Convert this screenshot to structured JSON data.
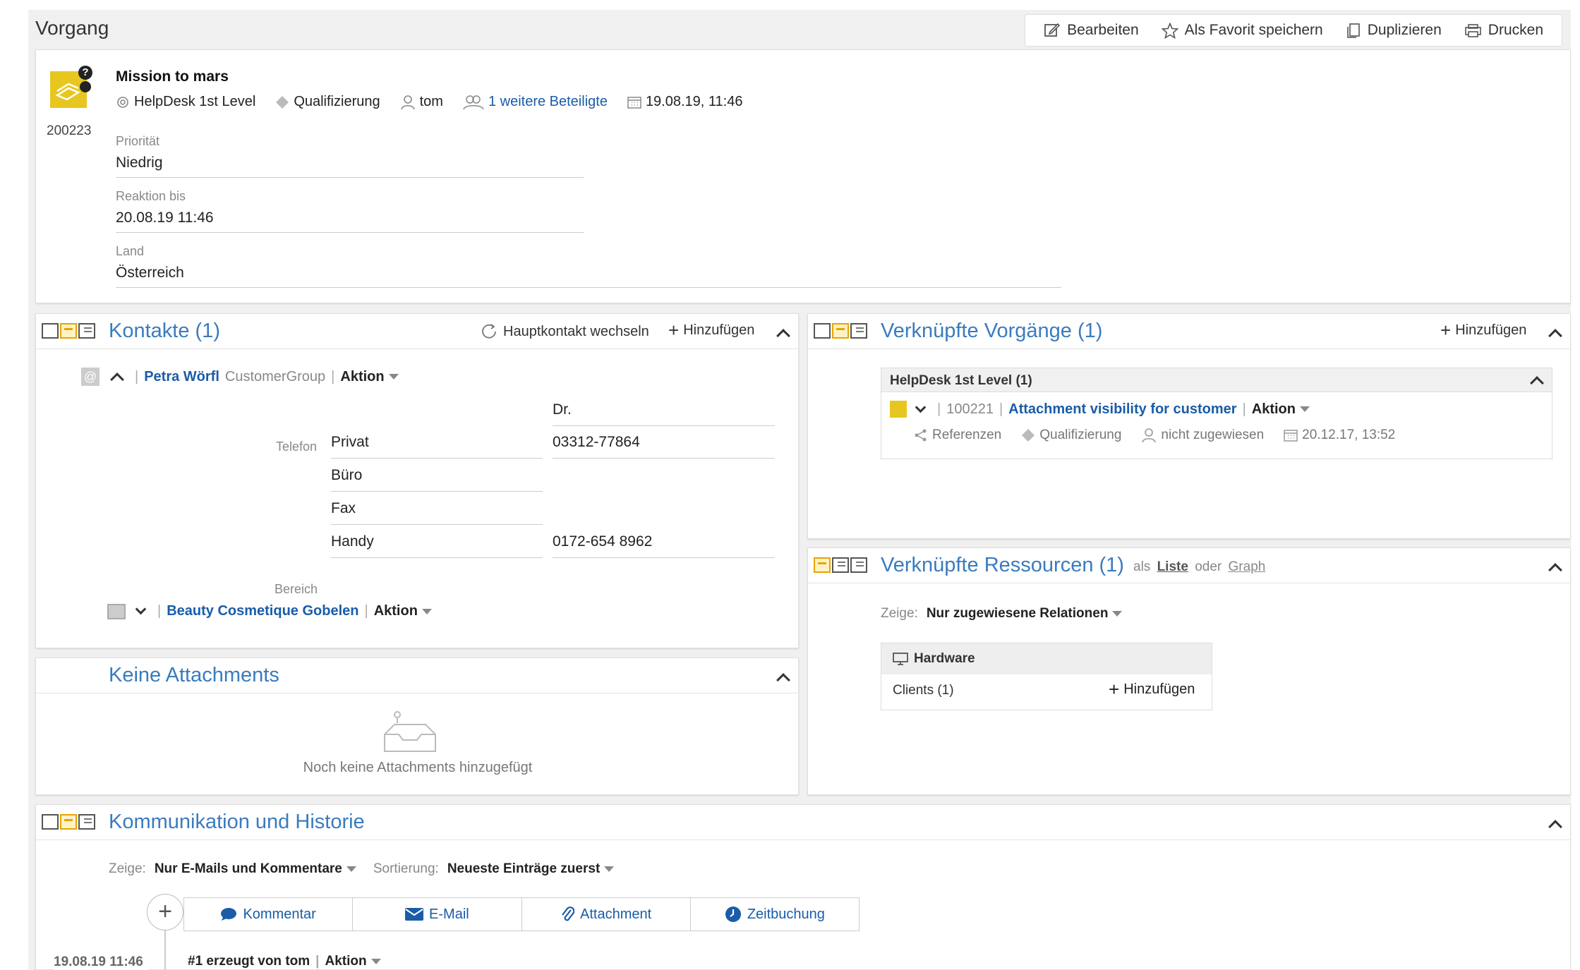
{
  "window": {
    "title": "Vorgang"
  },
  "toolbar": {
    "edit_label": "Bearbeiten",
    "favorite_label": "Als Favorit speichern",
    "duplicate_label": "Duplizieren",
    "print_label": "Drucken"
  },
  "ticket": {
    "number": "200223",
    "title": "Mission to mars",
    "queue": "HelpDesk 1st Level",
    "status": "Qualifizierung",
    "assignee": "tom",
    "participants": "1 weitere Beteiligte",
    "date": "19.08.19, 11:46",
    "fields": [
      {
        "label": "Priorität",
        "value": "Niedrig"
      },
      {
        "label": "Reaktion bis",
        "value": "20.08.19 11:46"
      },
      {
        "label": "Land",
        "value": "Österreich"
      }
    ]
  },
  "contacts": {
    "title": "Kontakte (1)",
    "switch_label": "Hauptkontakt wechseln",
    "add_label": "Hinzufügen",
    "person_name": "Petra Wörfl",
    "person_group": "CustomerGroup",
    "action_label": "Aktion",
    "salutation": "Dr.",
    "phone_label": "Telefon",
    "phones": [
      {
        "type": "Privat",
        "number": "03312-77864"
      },
      {
        "type": "Büro",
        "number": ""
      },
      {
        "type": "Fax",
        "number": ""
      },
      {
        "type": "Handy",
        "number": "0172-654 8962"
      }
    ],
    "area_label": "Bereich",
    "company_name": "Beauty Cosmetique Gobelen",
    "company_action": "Aktion"
  },
  "attachments": {
    "title": "Keine Attachments",
    "empty_text": "Noch keine Attachments hinzugefügt"
  },
  "linked_tickets": {
    "title": "Verknüpfte Vorgänge (1)",
    "add_label": "Hinzufügen",
    "group_title": "HelpDesk 1st Level (1)",
    "item": {
      "number": "100221",
      "title": "Attachment visibility for customer",
      "action": "Aktion",
      "meta_references": "Referenzen",
      "meta_status": "Qualifizierung",
      "meta_assignee": "nicht zugewiesen",
      "meta_date": "20.12.17, 13:52"
    }
  },
  "linked_resources": {
    "title": "Verknüpfte Ressourcen (1)",
    "view_prefix": "als",
    "view_list": "Liste",
    "view_or": "oder",
    "view_graph": "Graph",
    "show_label": "Zeige:",
    "show_value": "Nur zugewiesene Relationen",
    "table_header": "Hardware",
    "row_label": "Clients (1)",
    "row_add": "Hinzufügen"
  },
  "history": {
    "title": "Kommunikation und Historie",
    "show_label": "Zeige:",
    "show_value": "Nur E-Mails und Kommentare",
    "sort_label": "Sortierung:",
    "sort_value": "Neueste Einträge zuerst",
    "buttons": [
      "Kommentar",
      "E-Mail",
      "Attachment",
      "Zeitbuchung"
    ],
    "entry_date": "19.08.19 11:46",
    "entry_text": "#1 erzeugt von tom",
    "entry_action": "Aktion"
  },
  "colors": {
    "accent": "#3a7bbf",
    "link": "#1a5ca8",
    "background": "#f0f0f0",
    "ticket_icon": "#e8c620"
  }
}
